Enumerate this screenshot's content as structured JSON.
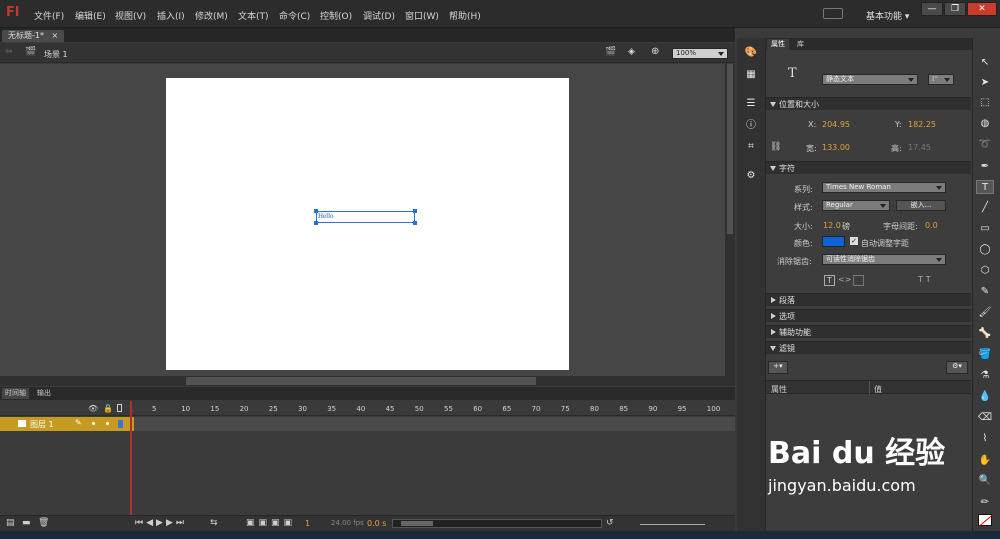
{
  "app": {
    "logo": "Fl"
  },
  "menu": {
    "items": [
      "文件(F)",
      "编辑(E)",
      "视图(V)",
      "插入(I)",
      "修改(M)",
      "文本(T)",
      "命令(C)",
      "控制(O)",
      "调试(D)",
      "窗口(W)",
      "帮助(H)"
    ],
    "workspace": "基本功能 ▾"
  },
  "document": {
    "tab": "无标题-1*",
    "tab_close": "×",
    "scene": "场景 1",
    "zoom": "100%"
  },
  "stage": {
    "text": "Hello"
  },
  "timeline": {
    "tabs": [
      "时间轴",
      "输出"
    ],
    "frame_numbers": [
      "1",
      "5",
      "10",
      "15",
      "20",
      "25",
      "30",
      "35",
      "40",
      "45",
      "50",
      "55",
      "60",
      "65",
      "70",
      "75",
      "80",
      "85",
      "90",
      "95",
      "100"
    ],
    "layer_name": "图层 1",
    "current_frame": "1",
    "fps": "24.00 fps",
    "time": "0.0 s"
  },
  "properties": {
    "tabs": [
      "属性",
      "库"
    ],
    "text_type": "静态文本",
    "section_position": "位置和大小",
    "x_label": "X:",
    "x_value": "204.95",
    "y_label": "Y:",
    "y_value": "182.25",
    "w_label": "宽:",
    "w_value": "133.00",
    "h_label": "高:",
    "h_value": "17.45",
    "section_char": "字符",
    "family_label": "系列:",
    "family_value": "Times New Roman",
    "style_label": "样式:",
    "style_value": "Regular",
    "embed_button": "嵌入...",
    "size_label": "大小:",
    "size_value": "12.0",
    "size_unit": "磅",
    "spacing_label": "字母间距:",
    "spacing_value": "0.0",
    "color_label": "颜色:",
    "auto_kern_label": "自动调整字距",
    "antialias_label": "消除锯齿:",
    "antialias_value": "可读性消除锯齿",
    "section_paragraph": "段落",
    "section_options": "选项",
    "section_accessibility": "辅助功能",
    "section_filters": "滤镜",
    "filter_col_prop": "属性",
    "filter_col_value": "值",
    "text_color": "#0e63d6"
  },
  "watermark": {
    "brand": "Bai du 经验",
    "url": "jingyan.baidu.com"
  }
}
